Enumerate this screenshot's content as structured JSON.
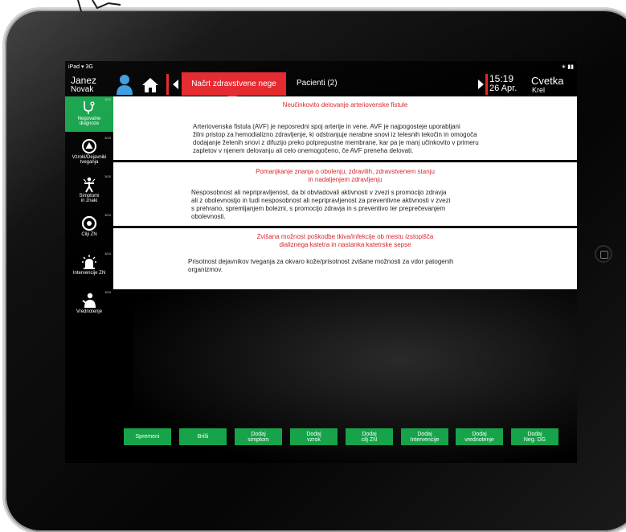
{
  "status_bar": {
    "carrier": "iPad",
    "signal": "3G",
    "battery": "battery-icon"
  },
  "header": {
    "user_first": "Janez",
    "user_last": "Novak",
    "active_tab": "Načrt zdravstvene nege",
    "tab_2": "Pacienti (2)",
    "time": "15:19",
    "date": "26 Apr.",
    "staff_first": "Cvetka",
    "staff_last": "Krel",
    "accent_color": "#e4262c"
  },
  "sidebar": {
    "items": [
      {
        "label_1": "Negovalne",
        "label_2": "diagnoze",
        "count": "3/10",
        "icon": "stethoscope-icon",
        "active": true
      },
      {
        "label_1": "Vzroki/Dejavniki",
        "label_2": "tveganja",
        "count": "3/10",
        "icon": "warning-circle-icon"
      },
      {
        "label_1": "Simptomi",
        "label_2": "in znaki",
        "count": "3/10",
        "icon": "symptom-figure-icon"
      },
      {
        "label_1": "Cilji ZN",
        "label_2": "",
        "count": "3/10",
        "icon": "target-icon"
      },
      {
        "label_1": "Intervencije ZN",
        "label_2": "",
        "count": "3/10",
        "icon": "siren-icon"
      },
      {
        "label_1": "Vrednotenje",
        "label_2": "",
        "count": "3/10",
        "icon": "evaluation-person-icon"
      }
    ],
    "active_color": "#16a34a"
  },
  "cards": [
    {
      "title_1": "Neučinkovito delovanje arteriovenske fistule",
      "title_2": "",
      "body_1": "Arteriovenska fistula (AVF) je neposredni spoj arterije in vene. AVF je najpogosteje uporabljani",
      "body_2": "žilni pristop za hemodializno zdravljenje, ki odstranjuje nerabne snovi iz telesnih tekočin in omogoča",
      "body_3": "dodajanje želenih snovi z difuzijo preko polprepustne membrane, kar pa je manj učinkovito v primeru",
      "body_4": "zapletov v njenem delovanju ali celo onemogočeno, če AVF preneha delovati."
    },
    {
      "title_1": "Pomanjkanje znanja o obolenju, zdravilih, zdravstvenem stanju",
      "title_2": "in nadaljenjem zdravljenju",
      "body_1": "Nesposobnost ali nepripravljenost, da bi obvladovali aktivnosti v zvezi s promocijo zdravja",
      "body_2": "ali z obolevnostjo in tudi nesposobnost ali nepripravljenost za preventivne aktivnosti v zvezi",
      "body_3": "s prehrano, spremljanjem bolezni, s promocijo zdravja in s preventivo ter preprečevanjem",
      "body_4": "obolevnosti."
    },
    {
      "title_1": "Zvišana možnost poškodbe tkiva/infekcije ob mestu izstopišča",
      "title_2": "dializnega katetra in nastanka katetrske sepse",
      "body_1": "Prisotnost dejavnikov tveganja za okvaro kože/prisotnost zvišane možnosti za vdor patogenih",
      "body_2": "organizmov.",
      "body_3": "",
      "body_4": ""
    }
  ],
  "toolbar": {
    "buttons": [
      {
        "line_1": "Spremeni",
        "line_2": ""
      },
      {
        "line_1": "Briši",
        "line_2": ""
      },
      {
        "line_1": "Dodaj",
        "line_2": "simptom"
      },
      {
        "line_1": "Dodaj",
        "line_2": "vzrok"
      },
      {
        "line_1": "Dodaj",
        "line_2": "cilj ZN"
      },
      {
        "line_1": "Dodaj",
        "line_2": "Intervencije"
      },
      {
        "line_1": "Dodaj",
        "line_2": "vrednotenje"
      },
      {
        "line_1": "Dodaj",
        "line_2": "Neg. DG"
      }
    ],
    "button_color": "#16a34a"
  }
}
